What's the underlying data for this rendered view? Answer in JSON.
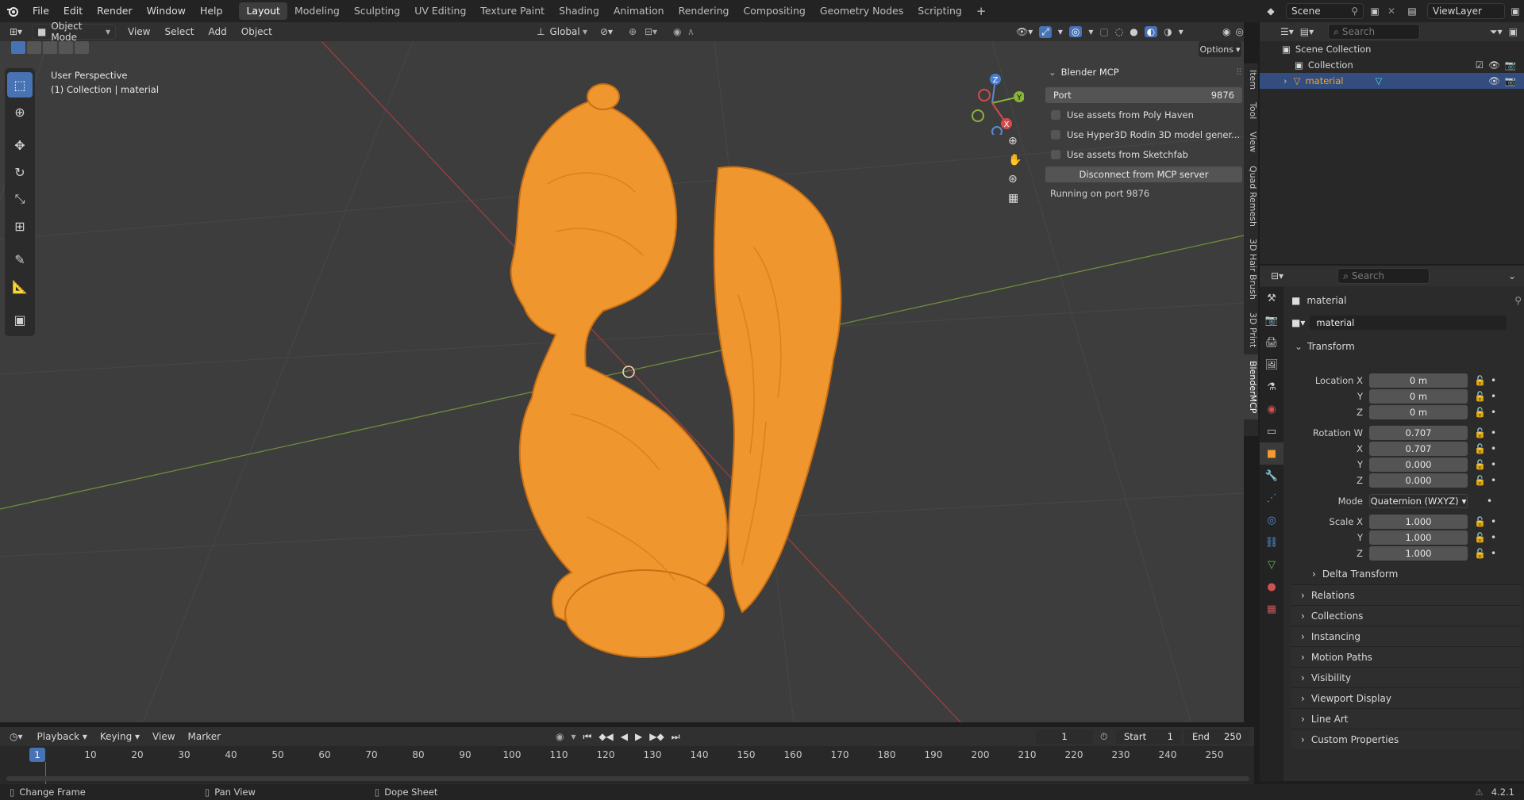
{
  "topbar": {
    "menus": [
      "File",
      "Edit",
      "Render",
      "Window",
      "Help"
    ],
    "workspaces": [
      "Layout",
      "Modeling",
      "Sculpting",
      "UV Editing",
      "Texture Paint",
      "Shading",
      "Animation",
      "Rendering",
      "Compositing",
      "Geometry Nodes",
      "Scripting"
    ],
    "active_workspace": "Layout",
    "add_workspace": "+",
    "scene": "Scene",
    "view_layer": "ViewLayer"
  },
  "viewport_header": {
    "mode": "Object Mode",
    "menus": [
      "View",
      "Select",
      "Add",
      "Object"
    ],
    "transform_orientation": "Global",
    "options": "Options"
  },
  "viewport": {
    "perspective": "User Perspective",
    "context": "(1) Collection | material",
    "gizmo": {
      "x": "X",
      "y": "Y",
      "z": "Z"
    }
  },
  "npanel": {
    "title": "Blender MCP",
    "port_label": "Port",
    "port_value": "9876",
    "options": [
      "Use assets from Poly Haven",
      "Use Hyper3D Rodin 3D model gener...",
      "Use assets from Sketchfab"
    ],
    "disconnect_button": "Disconnect from MCP server",
    "status": "Running on port 9876",
    "tabs": [
      "Item",
      "Tool",
      "View",
      "Quad Remesh",
      "3D Hair Brush",
      "3D Print",
      "BlenderMCP"
    ],
    "active_tab": "BlenderMCP"
  },
  "outliner": {
    "search_placeholder": "Search",
    "items": [
      {
        "label": "Scene Collection"
      },
      {
        "label": "Collection"
      },
      {
        "label": "material"
      }
    ]
  },
  "properties": {
    "search_placeholder": "Search",
    "object_name": "material",
    "object_field": "material",
    "transform_title": "Transform",
    "location_label": "Location X",
    "location": [
      "0 m",
      "0 m",
      "0 m"
    ],
    "rotation_label": "Rotation W",
    "rotation": [
      "0.707",
      "0.707",
      "0.000",
      "0.000"
    ],
    "mode_label": "Mode",
    "mode_value": "Quaternion (WXYZ)",
    "scale_label": "Scale X",
    "scale": [
      "1.000",
      "1.000",
      "1.000"
    ],
    "axis_labels": {
      "x": "X",
      "y": "Y",
      "z": "Z"
    },
    "sections": [
      "Delta Transform",
      "Relations",
      "Collections",
      "Instancing",
      "Motion Paths",
      "Visibility",
      "Viewport Display",
      "Line Art",
      "Custom Properties"
    ]
  },
  "timeline": {
    "menus": [
      "Playback",
      "Keying",
      "View",
      "Marker"
    ],
    "current_frame": "1",
    "start_label": "Start",
    "start_value": "1",
    "end_label": "End",
    "end_value": "250",
    "ticks": [
      "10",
      "20",
      "30",
      "40",
      "50",
      "60",
      "70",
      "80",
      "90",
      "100",
      "110",
      "120",
      "130",
      "140",
      "150",
      "160",
      "170",
      "180",
      "190",
      "200",
      "210",
      "220",
      "230",
      "240",
      "250"
    ],
    "playhead": "1"
  },
  "statusbar": {
    "items": [
      "Change Frame",
      "Pan View",
      "Dope Sheet"
    ],
    "version": "4.2.1"
  },
  "colors": {
    "accent": "#4772b3",
    "object": "#f0962e",
    "highlight_text": "#f5a623"
  }
}
